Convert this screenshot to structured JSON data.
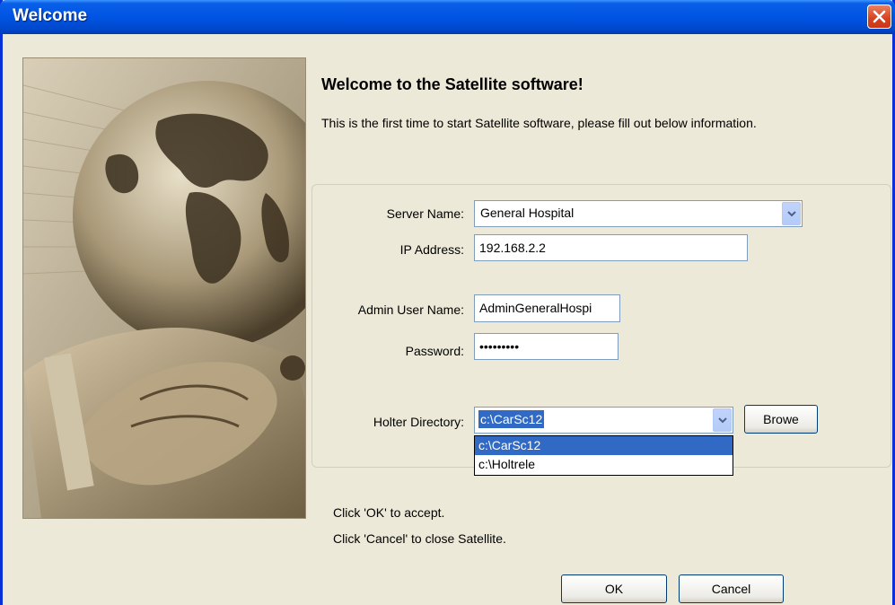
{
  "window": {
    "title": "Welcome"
  },
  "dialog": {
    "heading": "Welcome to the Satellite software!",
    "intro": "This is the first time to start Satellite software, please fill out below information."
  },
  "form": {
    "server_name_label": "Server Name:",
    "server_name_value": "General Hospital",
    "ip_label": "IP Address:",
    "ip_value": "192.168.2.2",
    "admin_label": "Admin User Name:",
    "admin_value": "AdminGeneralHospi",
    "password_label": "Password:",
    "password_value": "•••••••••",
    "holter_label": "Holter Directory:",
    "holter_value": "c:\\CarSc12",
    "holter_options": [
      "c:\\CarSc12",
      "c:\\Holtrele"
    ],
    "browse_label": "Browe"
  },
  "footer": {
    "ok_hint": "Click 'OK' to accept.",
    "cancel_hint": "Click 'Cancel' to close Satellite.",
    "ok_label": "OK",
    "cancel_label": "Cancel"
  }
}
